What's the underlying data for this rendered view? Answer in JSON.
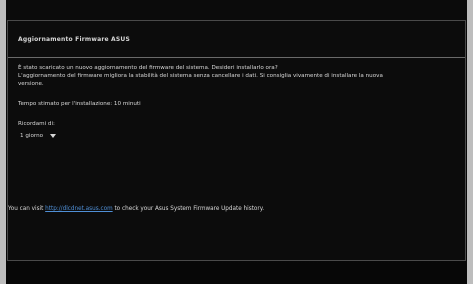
{
  "dialog": {
    "title": "Aggiornamento Firmware ASUS",
    "message_line1": "È stato scaricato un nuovo aggiornamento del firmware del sistema. Desideri installarlo ora?",
    "message_line2": "L'aggiornamento del firmware migliora la stabilità del sistema senza cancellare i dati. Si consiglia vivamente di installare la nuova",
    "message_line3": "versione.",
    "estimated_time": "Tempo stimato per l'installazione: 10 minuti",
    "reminder_label": "Ricordami di:",
    "reminder_value": "1 giorno",
    "footer_prefix": "You can visit ",
    "footer_link": "http://dlcdnet.asus.com",
    "footer_suffix": " to check your Asus System Firmware Update history."
  },
  "colors": {
    "background": "#0b0b0b",
    "text": "#d9d9d9",
    "link": "#4f8fd6",
    "border": "#6a6a6a"
  },
  "icons": {
    "dropdown": "chevron-down-icon"
  }
}
